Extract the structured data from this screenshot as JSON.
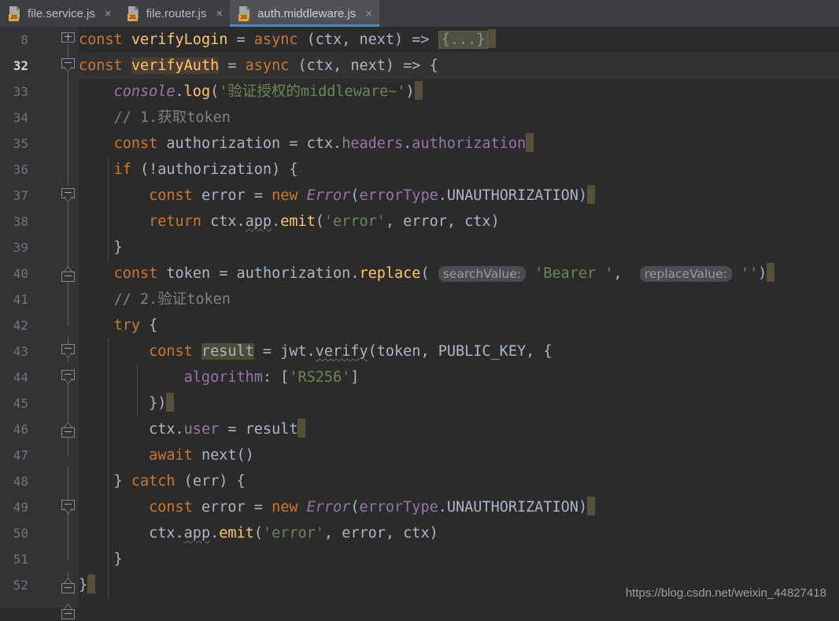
{
  "window": {
    "app": "code-editor",
    "theme_background": "#2B2B2B",
    "gutter_background": "#313335",
    "accent": "#4A88C7"
  },
  "tabs": [
    {
      "label": "file.service.js",
      "icon": "js-file-icon",
      "badge": "JS",
      "close": "×",
      "active": false
    },
    {
      "label": "file.router.js",
      "icon": "js-file-icon",
      "badge": "JS",
      "close": "×",
      "active": false
    },
    {
      "label": "auth.middleware.js",
      "icon": "js-file-icon",
      "badge": "JS",
      "close": "×",
      "active": true
    }
  ],
  "gutter": {
    "line_numbers": [
      "8",
      "32",
      "33",
      "34",
      "35",
      "36",
      "37",
      "38",
      "39",
      "40",
      "41",
      "42",
      "43",
      "44",
      "45",
      "46",
      "47",
      "48",
      "49",
      "50",
      "51",
      "52"
    ],
    "current_line_number": "32"
  },
  "code": {
    "fold_placeholder": "{...}",
    "hints": {
      "search_value": "searchValue:",
      "replace_value": "replaceValue:"
    },
    "lines": {
      "l8": {
        "number": "8",
        "text": "const verifyLogin = async (ctx, next) => {...}"
      },
      "l32": {
        "number": "32",
        "text": "const verifyAuth = async (ctx, next) => {"
      },
      "l33": {
        "number": "33",
        "text": "    console.log('验证授权的middleware~')"
      },
      "l34": {
        "number": "34",
        "text": "    // 1.获取token"
      },
      "l35": {
        "number": "35",
        "text": "    const authorization = ctx.headers.authorization"
      },
      "l36": {
        "number": "36",
        "text": "    if (!authorization) {"
      },
      "l37": {
        "number": "37",
        "text": "        const error = new Error(errorType.UNAUTHORIZATION)"
      },
      "l38": {
        "number": "38",
        "text": "        return ctx.app.emit('error', error, ctx)"
      },
      "l39": {
        "number": "39",
        "text": "    }"
      },
      "l40": {
        "number": "40",
        "text": "    const token = authorization.replace( searchValue: 'Bearer ',  replaceValue: '')"
      },
      "l41": {
        "number": "41",
        "text": "    // 2.验证token"
      },
      "l42": {
        "number": "42",
        "text": "    try {"
      },
      "l43": {
        "number": "43",
        "text": "        const result = jwt.verify(token, PUBLIC_KEY, {"
      },
      "l44": {
        "number": "44",
        "text": "            algorithm: ['RS256']"
      },
      "l45": {
        "number": "45",
        "text": "        })"
      },
      "l46": {
        "number": "46",
        "text": "        ctx.user = result"
      },
      "l47": {
        "number": "47",
        "text": "        await next()"
      },
      "l48": {
        "number": "48",
        "text": "    } catch (err) {"
      },
      "l49": {
        "number": "49",
        "text": "        const error = new Error(errorType.UNAUTHORIZATION)"
      },
      "l50": {
        "number": "50",
        "text": "        ctx.app.emit('error', error, ctx)"
      },
      "l51": {
        "number": "51",
        "text": "    }"
      },
      "l52": {
        "number": "52",
        "text": "}"
      }
    },
    "tokens": {
      "const": "const",
      "async": "async",
      "if": "if",
      "return": "return",
      "try": "try",
      "catch": "catch",
      "await": "await",
      "new": "new",
      "verifyLogin": "verifyLogin",
      "verifyAuth": "verifyAuth",
      "console": "console",
      "log": "log",
      "str_zh": "'验证授权的middleware~'",
      "cmt1": "// 1.获取token",
      "cmt2": "// 2.验证token",
      "authorization": "authorization",
      "ctx": "ctx",
      "headers": "headers",
      "error": "error",
      "Error": "Error",
      "errorType": "errorType",
      "UNAUTHORIZATION": "UNAUTHORIZATION",
      "app": "app",
      "emit": "emit",
      "str_error": "'error'",
      "token": "token",
      "replace": "replace",
      "str_bearer": "'Bearer '",
      "str_empty": "''",
      "result": "result",
      "jwt": "jwt",
      "verify": "verify",
      "PUBLIC_KEY": "PUBLIC_KEY",
      "algorithm": "algorithm",
      "str_rs256": "'RS256'",
      "user": "user",
      "next": "next",
      "err": "err"
    }
  },
  "watermark": {
    "text": "https://blog.csdn.net/weixin_44827418"
  }
}
